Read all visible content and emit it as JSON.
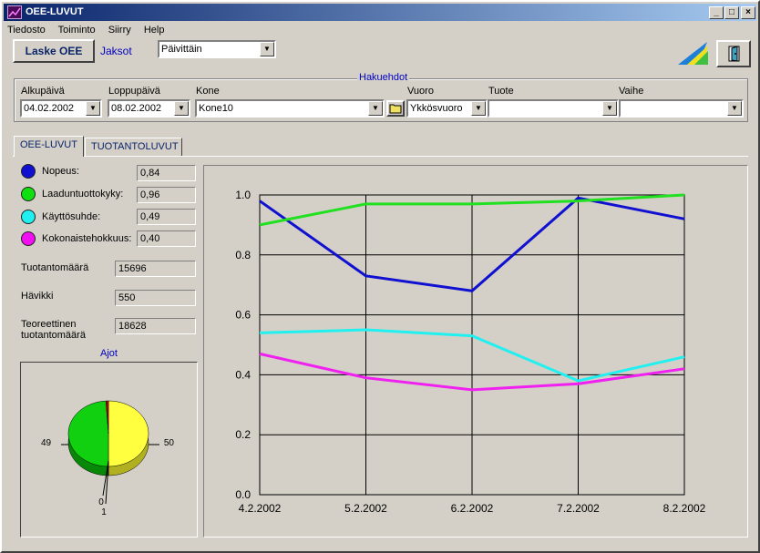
{
  "window": {
    "title": "OEE-LUVUT"
  },
  "menu": [
    "Tiedosto",
    "Toiminto",
    "Siirry",
    "Help"
  ],
  "toolbar": {
    "laske_label": "Laske OEE",
    "jaksot_label": "Jaksot",
    "jaksot_value": "Päivittäin"
  },
  "filters": {
    "legend": "Hakuehdot",
    "alkupaiva_label": "Alkupäivä",
    "alkupaiva_value": "04.02.2002",
    "loppupaiva_label": "Loppupäivä",
    "loppupaiva_value": "08.02.2002",
    "kone_label": "Kone",
    "kone_value": "Kone10",
    "vuoro_label": "Vuoro",
    "vuoro_value": "Ykkösvuoro",
    "tuote_label": "Tuote",
    "tuote_value": "",
    "vaihe_label": "Vaihe",
    "vaihe_value": ""
  },
  "tabs": [
    {
      "label": "OEE-LUVUT"
    },
    {
      "label": "TUOTANTOLUVUT"
    }
  ],
  "metrics": [
    {
      "label": "Nopeus:",
      "value": "0,84",
      "color": "#1010d0"
    },
    {
      "label": "Laaduntuottokyky:",
      "value": "0,96",
      "color": "#10e010"
    },
    {
      "label": "Käyttösuhde:",
      "value": "0,49",
      "color": "#20f0f0"
    },
    {
      "label": "Kokonaistehokkuus:",
      "value": "0,40",
      "color": "#f010f0"
    }
  ],
  "production": {
    "tuotantomaara_label": "Tuotantomäärä",
    "tuotantomaara_value": "15696",
    "havikki_label": "Hävikki",
    "havikki_value": "550",
    "teoreettinen_label_1": "Teoreettinen",
    "teoreettinen_label_2": "tuotantomäärä",
    "teoreettinen_value": "18628"
  },
  "pie": {
    "title": "Ajot",
    "slices": [
      {
        "label": "50",
        "value": 50,
        "color": "#ffff40"
      },
      {
        "label": "49",
        "value": 49,
        "color": "#10d010"
      },
      {
        "label": "1",
        "value": 1,
        "color": "#c00000"
      },
      {
        "label": "0",
        "value": 0,
        "color": "#0000c0"
      }
    ]
  },
  "chart_data": {
    "type": "line",
    "x": [
      "4.2.2002",
      "5.2.2002",
      "6.2.2002",
      "7.2.2002",
      "8.2.2002"
    ],
    "ylim": [
      0.0,
      1.0
    ],
    "yticks": [
      "0.0",
      "0.2",
      "0.4",
      "0.6",
      "0.8",
      "1.0"
    ],
    "grid": true,
    "series": [
      {
        "values": [
          0.98,
          0.73,
          0.68,
          0.99,
          0.92
        ],
        "color": "#1010d0"
      },
      {
        "values": [
          0.9,
          0.97,
          0.97,
          0.98,
          1.0
        ],
        "color": "#20e020"
      },
      {
        "values": [
          0.54,
          0.55,
          0.53,
          0.38,
          0.46
        ],
        "color": "#20f0f0"
      },
      {
        "values": [
          0.47,
          0.39,
          0.35,
          0.37,
          0.42
        ],
        "color": "#f020f0"
      }
    ]
  }
}
